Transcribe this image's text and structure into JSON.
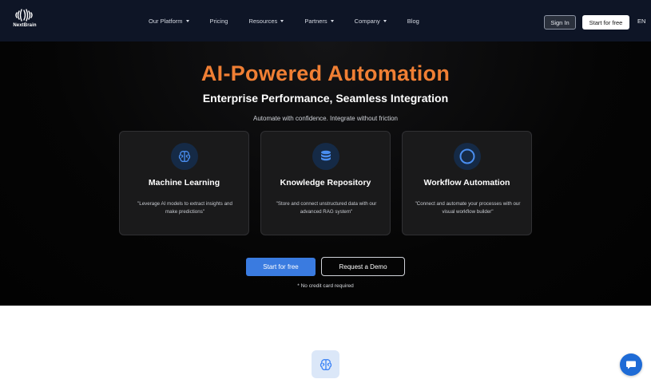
{
  "brand": {
    "name": "NextBrain"
  },
  "nav": {
    "items": [
      {
        "label": "Our Platform",
        "dropdown": true
      },
      {
        "label": "Pricing",
        "dropdown": false
      },
      {
        "label": "Resources",
        "dropdown": true
      },
      {
        "label": "Partners",
        "dropdown": true
      },
      {
        "label": "Company",
        "dropdown": true
      },
      {
        "label": "Blog",
        "dropdown": false
      }
    ],
    "signin_label": "Sign In",
    "start_label": "Start for free",
    "language": "EN"
  },
  "hero": {
    "title": "AI-Powered Automation",
    "subtitle": "Enterprise Performance, Seamless Integration",
    "tagline": "Automate with confidence. Integrate without friction",
    "cards": [
      {
        "icon": "brain-icon",
        "title": "Machine Learning",
        "description": "\"Leverage AI models to extract insights and make predictions\""
      },
      {
        "icon": "database-icon",
        "title": "Knowledge Repository",
        "description": "\"Store and connect unstructured data with our advanced RAG system\""
      },
      {
        "icon": "circle-icon",
        "title": "Workflow Automation",
        "description": "\"Connect and automate your processes with our visual workflow builder\""
      }
    ],
    "primary_cta": "Start for free",
    "secondary_cta": "Request a Demo",
    "note": "* No credit card required"
  },
  "colors": {
    "nav_bg": "#0e1526",
    "accent_orange": "#f07f34",
    "primary_blue": "#3a7be0",
    "icon_blue": "#3b82f6",
    "chat_blue": "#1e6bd6"
  }
}
